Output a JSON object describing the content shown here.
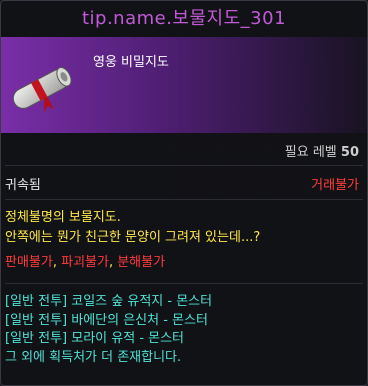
{
  "tooltip": {
    "title": "tip.name.보물지도_301",
    "item_name": "영웅 비밀지도",
    "icon": "scroll-map-icon",
    "required_level_label": "필요 레벨",
    "required_level": "50",
    "bind_status": "귀속됨",
    "trade_status": "거래불가",
    "description_lines": [
      "정체불명의 보물지도.",
      "안쪽에는 뭔가 친근한 문양이 그려져 있는데...?"
    ],
    "restrictions": [
      "판매불가",
      "파괴불가",
      "분해불가"
    ],
    "restriction_separator": ", ",
    "sources": [
      "[일반 전투] 코일즈 숲 유적지 - 몬스터",
      "[일반 전투] 바에단의 은신처 - 몬스터",
      "[일반 전투] 모라이 유적 - 몬스터"
    ],
    "sources_note": "그 외에 획득처가 더 존재합니다.",
    "colors": {
      "title": "#c15ad6",
      "header_band": "#7a2ea8",
      "description": "#ffe84a",
      "restriction": "#ff3b3b",
      "source": "#4fe2d6"
    }
  }
}
